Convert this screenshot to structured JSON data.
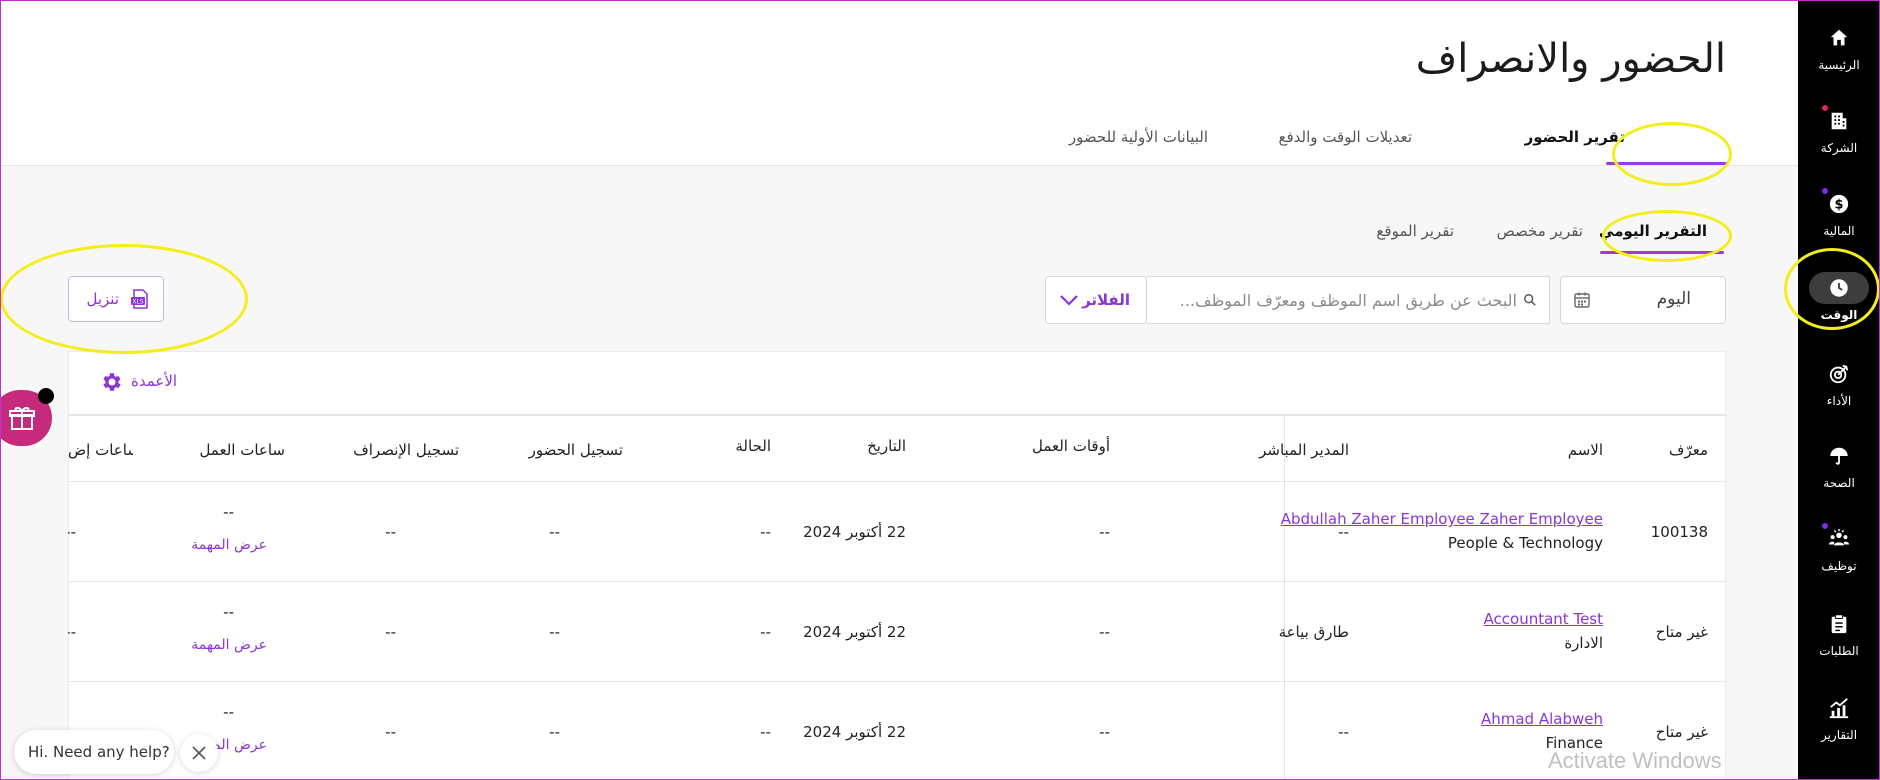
{
  "sidebar": {
    "items": [
      {
        "label": "الرئيسية",
        "icon": "home-icon"
      },
      {
        "label": "الشركة",
        "icon": "building-icon",
        "dot": "#e0245e"
      },
      {
        "label": "المالية",
        "icon": "dollar-icon",
        "dot": "#7b2cf0"
      },
      {
        "label": "الوقت",
        "icon": "clock-icon",
        "active": true
      },
      {
        "label": "الأداء",
        "icon": "target-icon"
      },
      {
        "label": "الصحة",
        "icon": "umbrella-icon"
      },
      {
        "label": "توظيف",
        "icon": "people-icon",
        "dot": "#7b2cf0"
      },
      {
        "label": "الطلبات",
        "icon": "clipboard-icon"
      },
      {
        "label": "التقارير",
        "icon": "chart-icon"
      }
    ]
  },
  "header": {
    "title": "الحضور والانصراف",
    "tabs": [
      {
        "label": "تقرير الحضور",
        "active": true
      },
      {
        "label": "تعديلات الوقت والدفع"
      },
      {
        "label": "البيانات الأولية للحضور"
      }
    ]
  },
  "subtabs": [
    {
      "label": "التقرير اليومي",
      "active": true
    },
    {
      "label": "تقرير مخصص"
    },
    {
      "label": "تقرير الموقع"
    }
  ],
  "toolbar": {
    "date_value": "اليوم",
    "search_placeholder": "البحث عن طريق اسم الموظف ومعرّف الموظف...",
    "filter_label": "الفلاتر",
    "download_label": "تنزيل"
  },
  "table": {
    "columns_label": "الأعمدة",
    "headers": {
      "id": "معرّف",
      "name": "الاسم",
      "manager": "المدير المباشر",
      "shift": "أوقات العمل",
      "date": "التاريخ",
      "status": "الحالة",
      "checkin": "تسجيل الحضور",
      "checkout": "تسجيل الإنصراف",
      "hours": "ساعات العمل",
      "extra": "ساعات إض"
    },
    "task_link_label": "عرض المهمة",
    "rows": [
      {
        "id": "100138",
        "name": "Abdullah Zaher Employee Zaher Employee",
        "dept": "People & Technology",
        "manager": "--",
        "shift": "--",
        "date": "22 أكتوبر 2024",
        "status": "--",
        "checkin": "--",
        "checkout": "--",
        "hours": "--",
        "extra": "--"
      },
      {
        "id": "غير متاح",
        "name": "Accountant Test",
        "dept": "الادارة",
        "manager": "طارق بياعة",
        "shift": "--",
        "date": "22 أكتوبر 2024",
        "status": "--",
        "checkin": "--",
        "checkout": "--",
        "hours": "--",
        "extra": "--"
      },
      {
        "id": "غير متاح",
        "name": "Ahmad Alabweh",
        "dept": "Finance",
        "manager": "--",
        "shift": "--",
        "date": "22 أكتوبر 2024",
        "status": "--",
        "checkin": "--",
        "checkout": "--",
        "hours": "--",
        "extra": "--"
      }
    ]
  },
  "help": {
    "text": "Hi. Need any help?"
  },
  "watermark": "Activate Windows",
  "colors": {
    "accent": "#8a35d6",
    "annotation": "#f3ee1b",
    "gift": "#c52a7c"
  }
}
